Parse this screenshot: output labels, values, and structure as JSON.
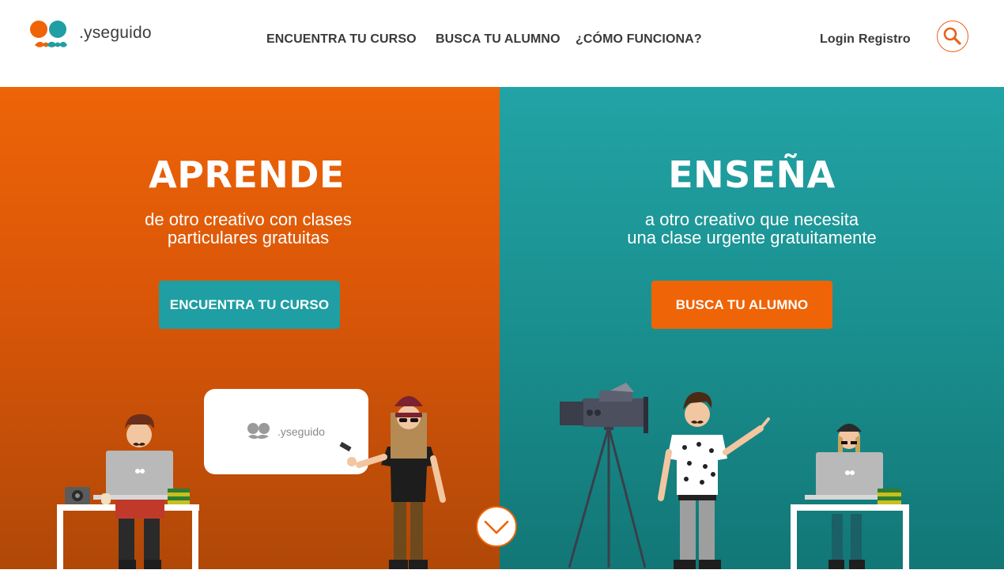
{
  "brand": {
    "name": ".yseguido",
    "orange": "#ee6407",
    "teal": "#1f9ea3"
  },
  "nav": {
    "items": [
      {
        "label": "ENCUENTRA TU CURSO"
      },
      {
        "label": "BUSCA TU  ALUMNO"
      },
      {
        "label": "¿CÓMO FUNCIONA?"
      }
    ],
    "login": "Login",
    "register": "Registro",
    "search_icon": "search-icon"
  },
  "learn": {
    "title": "APRENDE",
    "subtitle_line1": "de otro creativo con clases",
    "subtitle_line2": "particulares  gratuitas",
    "cta": "ENCUENTRA TU CURSO",
    "screen_logo": ".yseguido"
  },
  "teach": {
    "title": "ENSEÑA",
    "subtitle_line1": "a otro creativo que necesita",
    "subtitle_line2": "una clase urgente gratuitamente",
    "cta": "BUSCA TU ALUMNO"
  },
  "scroll_icon": "chevron-down-icon"
}
